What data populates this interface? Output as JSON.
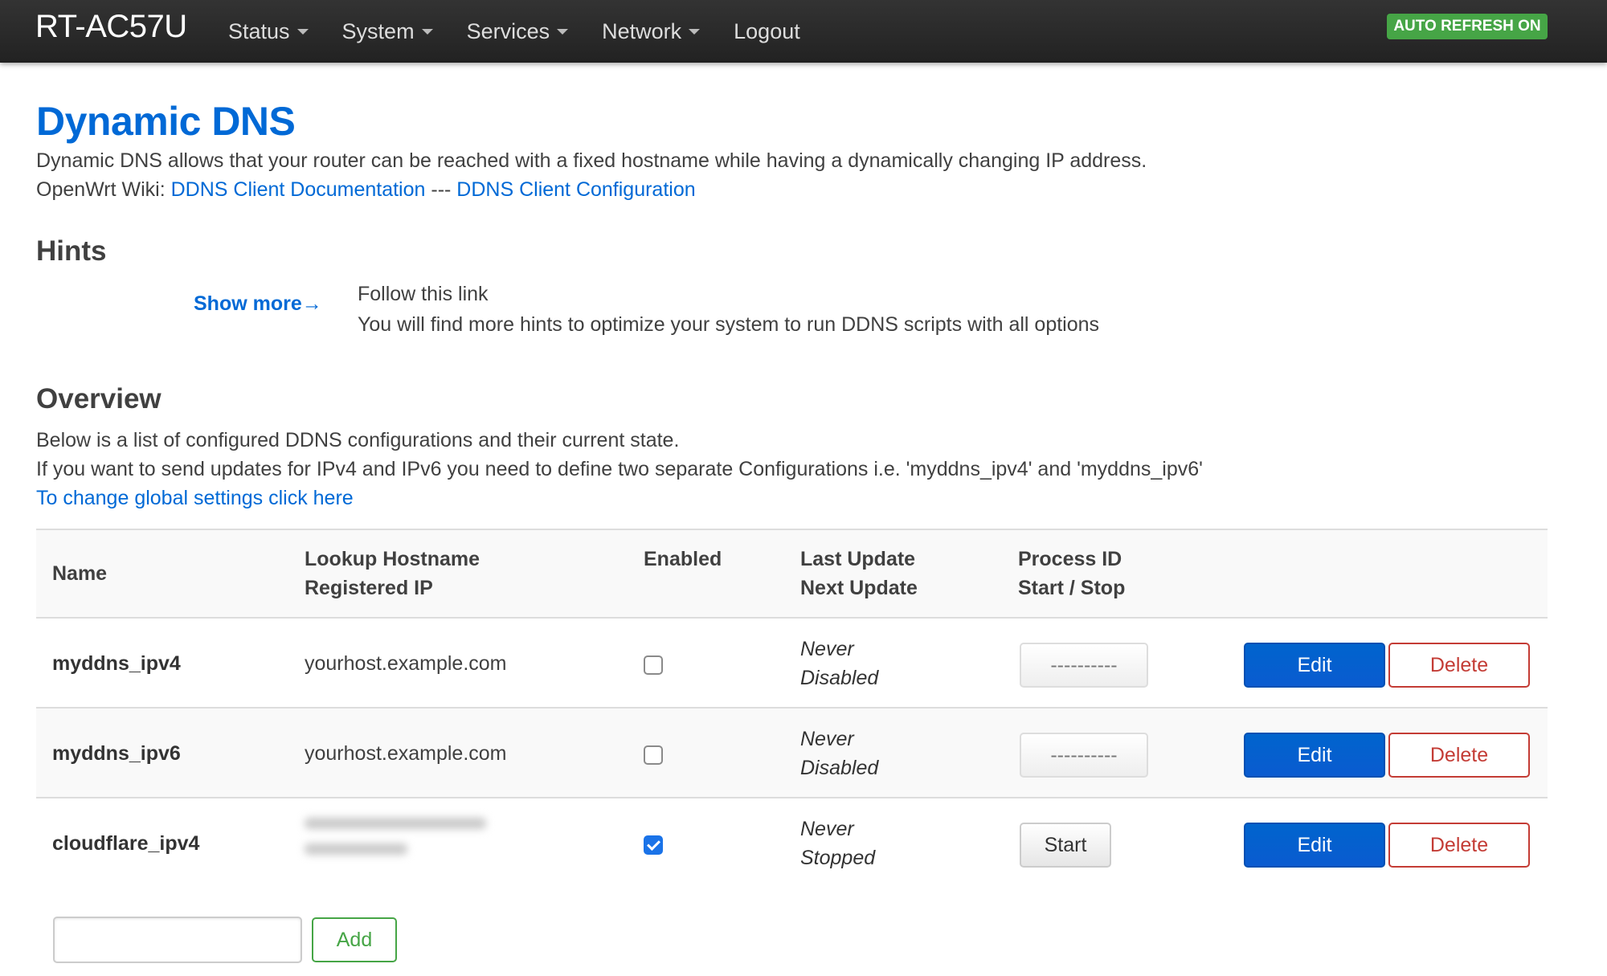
{
  "navbar": {
    "brand": "RT-AC57U",
    "menu": [
      "Status",
      "System",
      "Services",
      "Network"
    ],
    "logout": "Logout",
    "auto_refresh": "AUTO REFRESH ON",
    "colors": {
      "background": "#222222",
      "auto_refresh": "#46a546"
    }
  },
  "page": {
    "title": "Dynamic DNS",
    "description": "Dynamic DNS allows that your router can be reached with a fixed hostname while having a dynamically changing IP address.",
    "wiki_prefix": "OpenWrt Wiki: ",
    "doc_link": "DDNS Client Documentation",
    "separator": " --- ",
    "config_link": "DDNS Client Configuration",
    "link_color": "#0069d6"
  },
  "hints": {
    "heading": "Hints",
    "show_more": "Show more→",
    "line1": "Follow this link",
    "line2": "You will find more hints to optimize your system to run DDNS scripts with all options"
  },
  "overview": {
    "heading": "Overview",
    "line1": "Below is a list of configured DDNS configurations and their current state.",
    "line2": "If you want to send updates for IPv4 and IPv6 you need to define two separate Configurations i.e. 'myddns_ipv4' and 'myddns_ipv6'",
    "global_link": "To change global settings click here"
  },
  "table": {
    "headers": {
      "name": "Name",
      "lookup_hostname": "Lookup Hostname",
      "registered_ip": "Registered IP",
      "enabled": "Enabled",
      "last_update": "Last Update",
      "next_update": "Next Update",
      "process_id": "Process ID",
      "start_stop": "Start / Stop"
    },
    "rows": [
      {
        "name": "myddns_ipv4",
        "hostname": "yourhost.example.com",
        "enabled": false,
        "last_update": "Never",
        "next_update": "Disabled",
        "action": "----------",
        "edit": "Edit",
        "delete": "Delete"
      },
      {
        "name": "myddns_ipv6",
        "hostname": "yourhost.example.com",
        "enabled": false,
        "last_update": "Never",
        "next_update": "Disabled",
        "action": "----------",
        "edit": "Edit",
        "delete": "Delete"
      },
      {
        "name": "cloudflare_ipv4",
        "enabled": true,
        "last_update": "Never",
        "next_update": "Stopped",
        "action": "Start",
        "edit": "Edit",
        "delete": "Delete"
      }
    ]
  },
  "add": {
    "input_value": "",
    "button": "Add"
  },
  "status_colors": {
    "edit": "#0064cd",
    "delete": "#c43c35",
    "add": "#46a546"
  }
}
